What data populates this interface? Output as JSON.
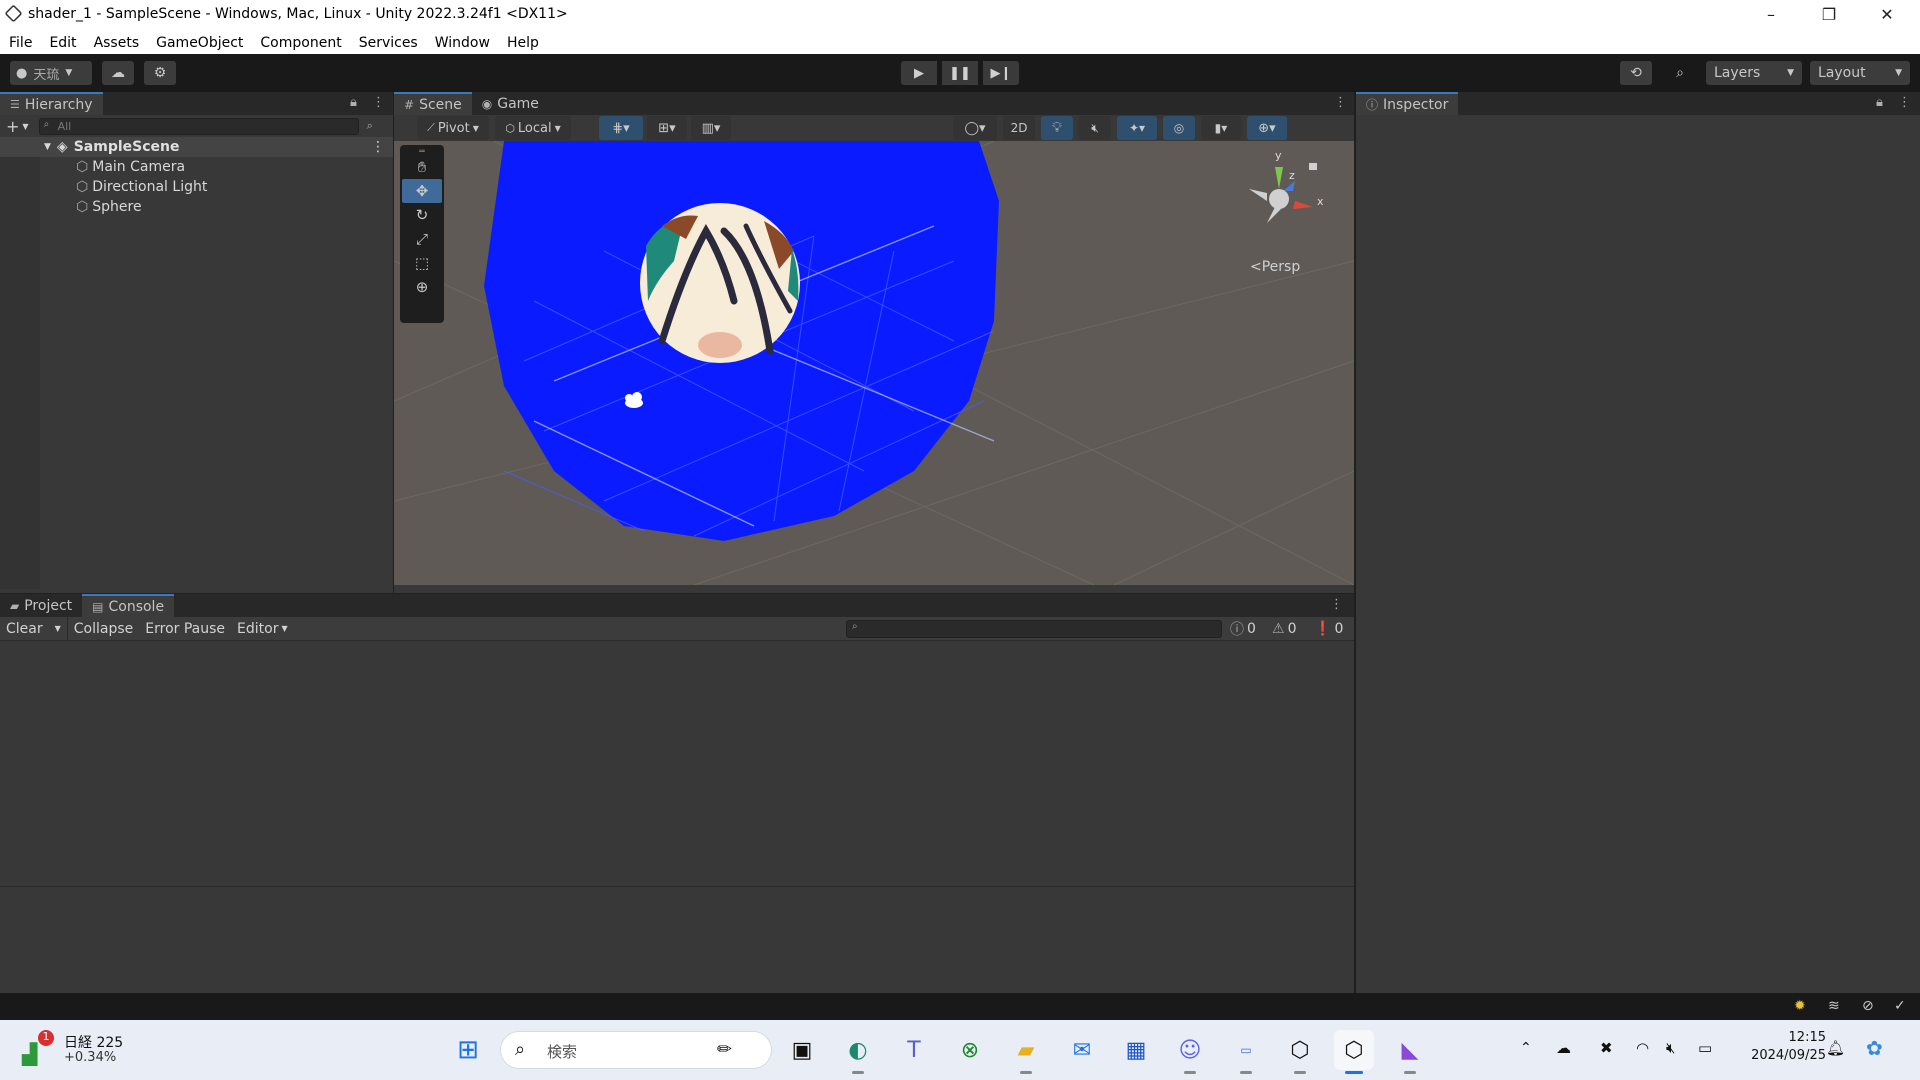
{
  "window": {
    "title": "shader_1 - SampleScene - Windows, Mac, Linux - Unity 2022.3.24f1 <DX11>",
    "minimize": "–",
    "restore": "❐",
    "close": "✕"
  },
  "menu": [
    "File",
    "Edit",
    "Assets",
    "GameObject",
    "Component",
    "Services",
    "Window",
    "Help"
  ],
  "toolbar": {
    "account_label": "天琉",
    "layers_label": "Layers",
    "layout_label": "Layout"
  },
  "hierarchy": {
    "tab_label": "Hierarchy",
    "search_placeholder": "All",
    "scene_name": "SampleScene",
    "objects": [
      "Main Camera",
      "Directional Light",
      "Sphere"
    ]
  },
  "scene_view": {
    "tabs": [
      "Scene",
      "Game"
    ],
    "pivot_label": "Pivot",
    "local_label": "Local",
    "mode_2d_label": "2D",
    "gizmo_axes": {
      "y": "y",
      "z": "z",
      "x": "x"
    },
    "projection_label": "Persp"
  },
  "inspector": {
    "tab_label": "Inspector"
  },
  "console": {
    "tabs": [
      "Project",
      "Console"
    ],
    "clear_label": "Clear",
    "collapse_label": "Collapse",
    "error_pause_label": "Error Pause",
    "editor_label": "Editor",
    "log_count": "0",
    "warning_count": "0",
    "error_count": "0"
  },
  "taskbar": {
    "widget_title": "日経 225",
    "widget_value": "+0.34%",
    "widget_badge": "1",
    "search_placeholder": "検索",
    "time": "12:15",
    "date": "2024/09/25"
  },
  "colors": {
    "accent": "#3a79bb",
    "plane_blue": "#0a1cff",
    "viewport_bg": "#5f5a55"
  }
}
